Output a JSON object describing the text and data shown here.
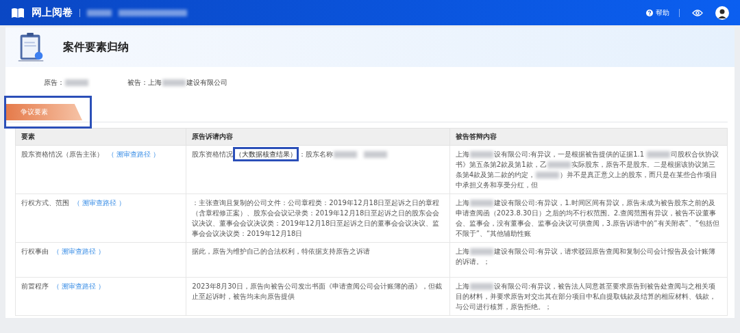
{
  "header": {
    "app_title": "网上阅卷",
    "help": "帮助"
  },
  "page": {
    "title": "案件要素归纳"
  },
  "parties": [
    {
      "label": "原告：",
      "segments": [
        {
          "kind": "redacted"
        }
      ]
    },
    {
      "label": "被告：",
      "segments": [
        {
          "kind": "text",
          "text": "上海"
        },
        {
          "kind": "redacted"
        },
        {
          "kind": "text",
          "text": "建设有限公司"
        }
      ]
    }
  ],
  "tabs": [
    {
      "label": "争议要素",
      "selected": true,
      "annotated": true
    }
  ],
  "table": {
    "columns": [
      "要素",
      "原告诉请内容",
      "被告答辩内容"
    ],
    "rows": [
      {
        "element": "股东资格情况（原告主张）",
        "link": "（ 溯审查路径 ）",
        "plaintiff": [
          {
            "kind": "text",
            "text": "股东资格情况"
          },
          {
            "kind": "boxed",
            "text": "（大数据核查结果）"
          },
          {
            "kind": "text",
            "text": "：股东名称"
          },
          {
            "kind": "redacted"
          },
          {
            "kind": "gap"
          },
          {
            "kind": "redacted"
          }
        ],
        "defendant": [
          {
            "kind": "text",
            "text": "上海"
          },
          {
            "kind": "redacted"
          },
          {
            "kind": "text",
            "text": "设有限公司:有异议，一是根据被告提供的证据1.1 "
          },
          {
            "kind": "redacted"
          },
          {
            "kind": "text",
            "text": "司股权合伙协议书》第五条第2款及第1款，乙"
          },
          {
            "kind": "redacted"
          },
          {
            "kind": "text",
            "text": "实际股东，原告不是股东。二是根据该协议第三条第4款及第二款的约定，"
          },
          {
            "kind": "redacted"
          },
          {
            "kind": "text",
            "text": "）并不是真正意义上的股东，而只是在某些合作项目中承担义务和享受分红，但"
          }
        ]
      },
      {
        "element": "行权方式、范围",
        "link": "（ 溯审查路径 ）",
        "plaintiff": [
          {
            "kind": "text",
            "text": "：主张查询且复制的公司文件：公司章程类：2019年12月18日至起诉之日的章程（含章程修正案）、股东会会议记录类：2019年12月18日至起诉之日的股东会会议决议、董事会会议决议类：2019年12月18日至起诉之日的董事会会议决议、监事会会议决议类：2019年12月18日"
          }
        ],
        "defendant": [
          {
            "kind": "text",
            "text": "上海"
          },
          {
            "kind": "redacted"
          },
          {
            "kind": "text",
            "text": "建设有限公司:有异议，1.时间区间有异议，原告未成为被告股东之前的及申请查阅函（2023.8.30日）之后的均不行权范围。2.查阅范围有异议，被告不设董事会、监事会，没有董事会、监事会决议可供查阅，3.原告诉请中的“有关附表”、“包括但不限于”、“其他辅助性账"
          }
        ]
      },
      {
        "element": "行权事由",
        "link": "（ 溯审查路径 ）",
        "plaintiff": [
          {
            "kind": "text",
            "text": "据此，原告为维护自己的合法权利，特依据支持原告之诉请"
          }
        ],
        "defendant": [
          {
            "kind": "text",
            "text": "上海"
          },
          {
            "kind": "redacted"
          },
          {
            "kind": "text",
            "text": "建设有限公司:有异议，请求驳回原告查阅和复制公司会计报告及会计账簿的诉请。；"
          }
        ]
      },
      {
        "element": "前置程序",
        "link": "（ 溯审查路径 ）",
        "plaintiff": [
          {
            "kind": "text",
            "text": "2023年8月30日，原告向被告公司发出书面《申请查阅公司会计账簿的函》，但截止至起诉时，被告均未向原告提供"
          }
        ],
        "defendant": [
          {
            "kind": "text",
            "text": "上海"
          },
          {
            "kind": "redacted"
          },
          {
            "kind": "text",
            "text": "设有限公司:有异议，被告法人同意甚至要求原告到被告处查阅与之相关项目的材料，并要求原告对交出其在部分项目中私自提取钱款及结算的相应材料、钱款，与公司进行核算，原告拒绝。；"
          }
        ]
      }
    ]
  }
}
